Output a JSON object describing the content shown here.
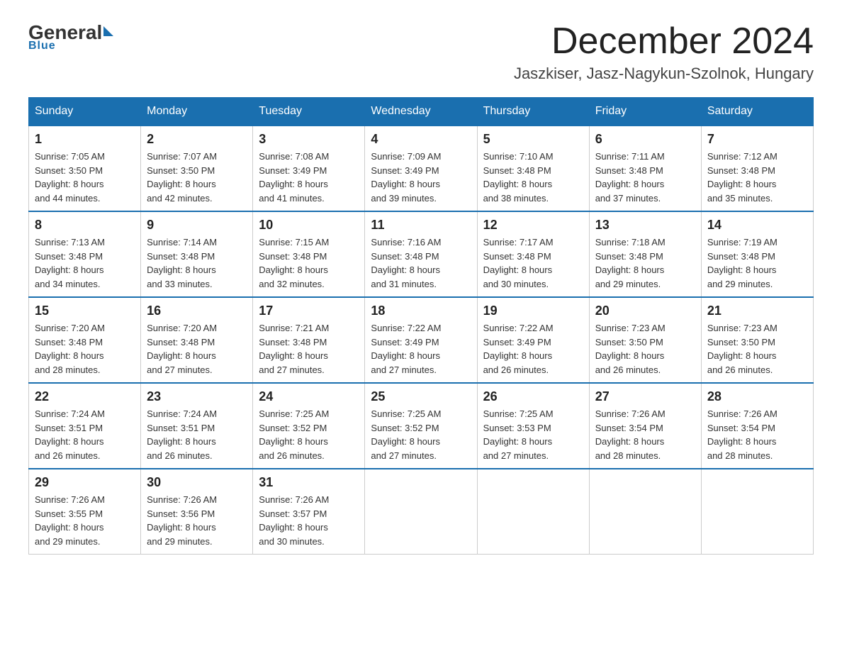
{
  "logo": {
    "general": "General",
    "blue": "Blue",
    "underline": "Blue"
  },
  "title": {
    "month": "December 2024",
    "location": "Jaszkiser, Jasz-Nagykun-Szolnok, Hungary"
  },
  "days_of_week": [
    "Sunday",
    "Monday",
    "Tuesday",
    "Wednesday",
    "Thursday",
    "Friday",
    "Saturday"
  ],
  "weeks": [
    [
      {
        "date": "1",
        "sunrise": "7:05 AM",
        "sunset": "3:50 PM",
        "daylight": "8 hours and 44 minutes."
      },
      {
        "date": "2",
        "sunrise": "7:07 AM",
        "sunset": "3:50 PM",
        "daylight": "8 hours and 42 minutes."
      },
      {
        "date": "3",
        "sunrise": "7:08 AM",
        "sunset": "3:49 PM",
        "daylight": "8 hours and 41 minutes."
      },
      {
        "date": "4",
        "sunrise": "7:09 AM",
        "sunset": "3:49 PM",
        "daylight": "8 hours and 39 minutes."
      },
      {
        "date": "5",
        "sunrise": "7:10 AM",
        "sunset": "3:48 PM",
        "daylight": "8 hours and 38 minutes."
      },
      {
        "date": "6",
        "sunrise": "7:11 AM",
        "sunset": "3:48 PM",
        "daylight": "8 hours and 37 minutes."
      },
      {
        "date": "7",
        "sunrise": "7:12 AM",
        "sunset": "3:48 PM",
        "daylight": "8 hours and 35 minutes."
      }
    ],
    [
      {
        "date": "8",
        "sunrise": "7:13 AM",
        "sunset": "3:48 PM",
        "daylight": "8 hours and 34 minutes."
      },
      {
        "date": "9",
        "sunrise": "7:14 AM",
        "sunset": "3:48 PM",
        "daylight": "8 hours and 33 minutes."
      },
      {
        "date": "10",
        "sunrise": "7:15 AM",
        "sunset": "3:48 PM",
        "daylight": "8 hours and 32 minutes."
      },
      {
        "date": "11",
        "sunrise": "7:16 AM",
        "sunset": "3:48 PM",
        "daylight": "8 hours and 31 minutes."
      },
      {
        "date": "12",
        "sunrise": "7:17 AM",
        "sunset": "3:48 PM",
        "daylight": "8 hours and 30 minutes."
      },
      {
        "date": "13",
        "sunrise": "7:18 AM",
        "sunset": "3:48 PM",
        "daylight": "8 hours and 29 minutes."
      },
      {
        "date": "14",
        "sunrise": "7:19 AM",
        "sunset": "3:48 PM",
        "daylight": "8 hours and 29 minutes."
      }
    ],
    [
      {
        "date": "15",
        "sunrise": "7:20 AM",
        "sunset": "3:48 PM",
        "daylight": "8 hours and 28 minutes."
      },
      {
        "date": "16",
        "sunrise": "7:20 AM",
        "sunset": "3:48 PM",
        "daylight": "8 hours and 27 minutes."
      },
      {
        "date": "17",
        "sunrise": "7:21 AM",
        "sunset": "3:48 PM",
        "daylight": "8 hours and 27 minutes."
      },
      {
        "date": "18",
        "sunrise": "7:22 AM",
        "sunset": "3:49 PM",
        "daylight": "8 hours and 27 minutes."
      },
      {
        "date": "19",
        "sunrise": "7:22 AM",
        "sunset": "3:49 PM",
        "daylight": "8 hours and 26 minutes."
      },
      {
        "date": "20",
        "sunrise": "7:23 AM",
        "sunset": "3:50 PM",
        "daylight": "8 hours and 26 minutes."
      },
      {
        "date": "21",
        "sunrise": "7:23 AM",
        "sunset": "3:50 PM",
        "daylight": "8 hours and 26 minutes."
      }
    ],
    [
      {
        "date": "22",
        "sunrise": "7:24 AM",
        "sunset": "3:51 PM",
        "daylight": "8 hours and 26 minutes."
      },
      {
        "date": "23",
        "sunrise": "7:24 AM",
        "sunset": "3:51 PM",
        "daylight": "8 hours and 26 minutes."
      },
      {
        "date": "24",
        "sunrise": "7:25 AM",
        "sunset": "3:52 PM",
        "daylight": "8 hours and 26 minutes."
      },
      {
        "date": "25",
        "sunrise": "7:25 AM",
        "sunset": "3:52 PM",
        "daylight": "8 hours and 27 minutes."
      },
      {
        "date": "26",
        "sunrise": "7:25 AM",
        "sunset": "3:53 PM",
        "daylight": "8 hours and 27 minutes."
      },
      {
        "date": "27",
        "sunrise": "7:26 AM",
        "sunset": "3:54 PM",
        "daylight": "8 hours and 28 minutes."
      },
      {
        "date": "28",
        "sunrise": "7:26 AM",
        "sunset": "3:54 PM",
        "daylight": "8 hours and 28 minutes."
      }
    ],
    [
      {
        "date": "29",
        "sunrise": "7:26 AM",
        "sunset": "3:55 PM",
        "daylight": "8 hours and 29 minutes."
      },
      {
        "date": "30",
        "sunrise": "7:26 AM",
        "sunset": "3:56 PM",
        "daylight": "8 hours and 29 minutes."
      },
      {
        "date": "31",
        "sunrise": "7:26 AM",
        "sunset": "3:57 PM",
        "daylight": "8 hours and 30 minutes."
      },
      null,
      null,
      null,
      null
    ]
  ],
  "labels": {
    "sunrise_prefix": "Sunrise: ",
    "sunset_prefix": "Sunset: ",
    "daylight_prefix": "Daylight: "
  }
}
